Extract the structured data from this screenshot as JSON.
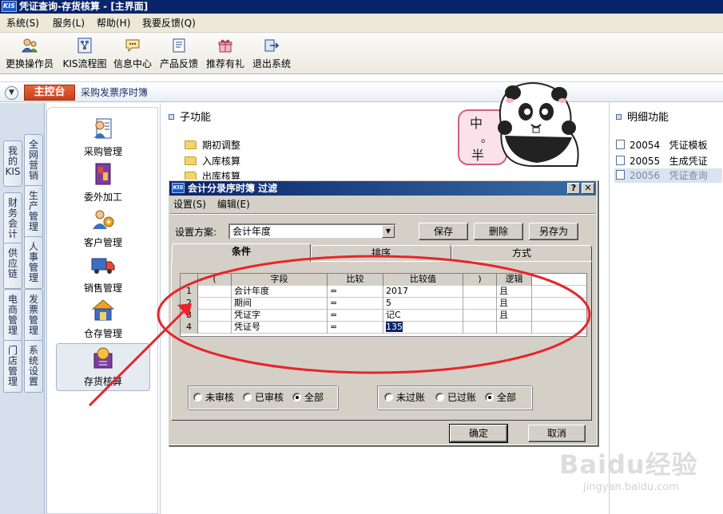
{
  "window": {
    "logo": "KIS",
    "title": "凭证查询-存货核算 - [主界面]"
  },
  "menubar": [
    "系统(S)",
    "服务(L)",
    "帮助(H)",
    "我要反馈(Q)"
  ],
  "toolbar": [
    {
      "label": "更换操作员",
      "icon": "switch-user-icon"
    },
    {
      "label": "KIS流程图",
      "icon": "flowchart-icon"
    },
    {
      "label": "信息中心",
      "icon": "message-icon"
    },
    {
      "label": "产品反馈",
      "icon": "feedback-icon"
    },
    {
      "label": "推荐有礼",
      "icon": "gift-icon"
    },
    {
      "label": "退出系统",
      "icon": "exit-icon"
    }
  ],
  "breadcrumb": {
    "home": "主控台",
    "current": "采购发票序时簿"
  },
  "left_tabs": [
    {
      "label": "我的KIS"
    },
    {
      "label": "财务会计"
    },
    {
      "label": "供应链"
    },
    {
      "label": "电商管理"
    },
    {
      "label": "门店管理"
    },
    {
      "label": "全网营销"
    },
    {
      "label": "生产管理"
    },
    {
      "label": "人事管理"
    },
    {
      "label": "发票管理"
    },
    {
      "label": "系统设置"
    }
  ],
  "modules": [
    "采购管理",
    "委外加工",
    "客户管理",
    "销售管理",
    "仓存管理",
    "存货核算"
  ],
  "sub_panel": {
    "title": "子功能",
    "items": [
      "期初调整",
      "入库核算",
      "出库核算"
    ]
  },
  "detail_panel": {
    "title": "明细功能",
    "items": [
      {
        "code": "20054",
        "name": "凭证模板"
      },
      {
        "code": "20055",
        "name": "生成凭证"
      },
      {
        "code": "20056",
        "name": "凭证查询"
      }
    ]
  },
  "sticker": {
    "text_top": "中",
    "text_mid": "。",
    "text_bot": "半"
  },
  "dialog": {
    "logo": "KIS",
    "title": "会计分录序时簿  过滤",
    "menu": [
      "设置(S)",
      "编辑(E)"
    ],
    "scheme_label": "设置方案:",
    "scheme_value": "会计年度",
    "buttons": {
      "save": "保存",
      "delete": "删除",
      "save_as": "另存为",
      "ok": "确定",
      "cancel": "取消"
    },
    "tabs": [
      "条件",
      "排序",
      "方式"
    ],
    "grid": {
      "headers": [
        "",
        "(",
        "字段",
        "比较",
        "比较值",
        ")",
        "逻辑"
      ],
      "rows": [
        {
          "n": "1",
          "lp": "",
          "field": "会计年度",
          "cmp": "=",
          "val": "2017",
          "rp": "",
          "logic": "且"
        },
        {
          "n": "2",
          "lp": "",
          "field": "期间",
          "cmp": "=",
          "val": "5",
          "rp": "",
          "logic": "且"
        },
        {
          "n": "3",
          "lp": "",
          "field": "凭证字",
          "cmp": "=",
          "val": "记C",
          "rp": "",
          "logic": "且"
        },
        {
          "n": "4",
          "lp": "",
          "field": "凭证号",
          "cmp": "=",
          "val": "135",
          "rp": "",
          "logic": ""
        }
      ]
    },
    "audit_group": [
      "未审核",
      "已审核",
      "全部"
    ],
    "audit_selected": "全部",
    "post_group": [
      "未过账",
      "已过账",
      "全部"
    ],
    "post_selected": "全部"
  },
  "annotation_color": "#e8252b",
  "watermark": {
    "brand": "Baidu经验",
    "url": "jingyan.baidu.com"
  }
}
